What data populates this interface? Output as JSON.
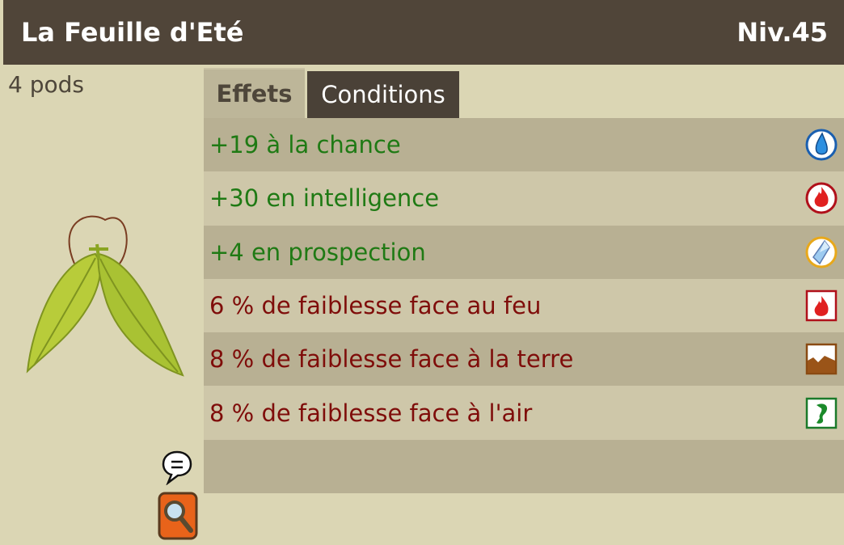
{
  "item": {
    "name": "La Feuille d'Eté",
    "level": "Niv.45",
    "weight": "4 pods"
  },
  "tabs": [
    {
      "label": "Effets",
      "active": true
    },
    {
      "label": "Conditions",
      "active": false
    }
  ],
  "effects": [
    {
      "text": "+19 à la chance",
      "type": "positive",
      "icon": "water-drop-icon"
    },
    {
      "text": "+30 en intelligence",
      "type": "positive",
      "icon": "fire-icon"
    },
    {
      "text": "+4 en prospection",
      "type": "positive",
      "icon": "prospection-crystal-icon"
    },
    {
      "text": "6 % de faiblesse face au feu",
      "type": "negative",
      "icon": "fire-resistance-icon"
    },
    {
      "text": "8 % de faiblesse face à la terre",
      "type": "negative",
      "icon": "earth-resistance-icon"
    },
    {
      "text": "8 % de faiblesse face à l'air",
      "type": "negative",
      "icon": "air-resistance-icon"
    }
  ],
  "colors": {
    "header_bg": "#504539",
    "positive_text": "#1f7a14",
    "negative_text": "#7f0d0a",
    "row_dark": "#b8b093",
    "row_light": "#cec7a9"
  }
}
